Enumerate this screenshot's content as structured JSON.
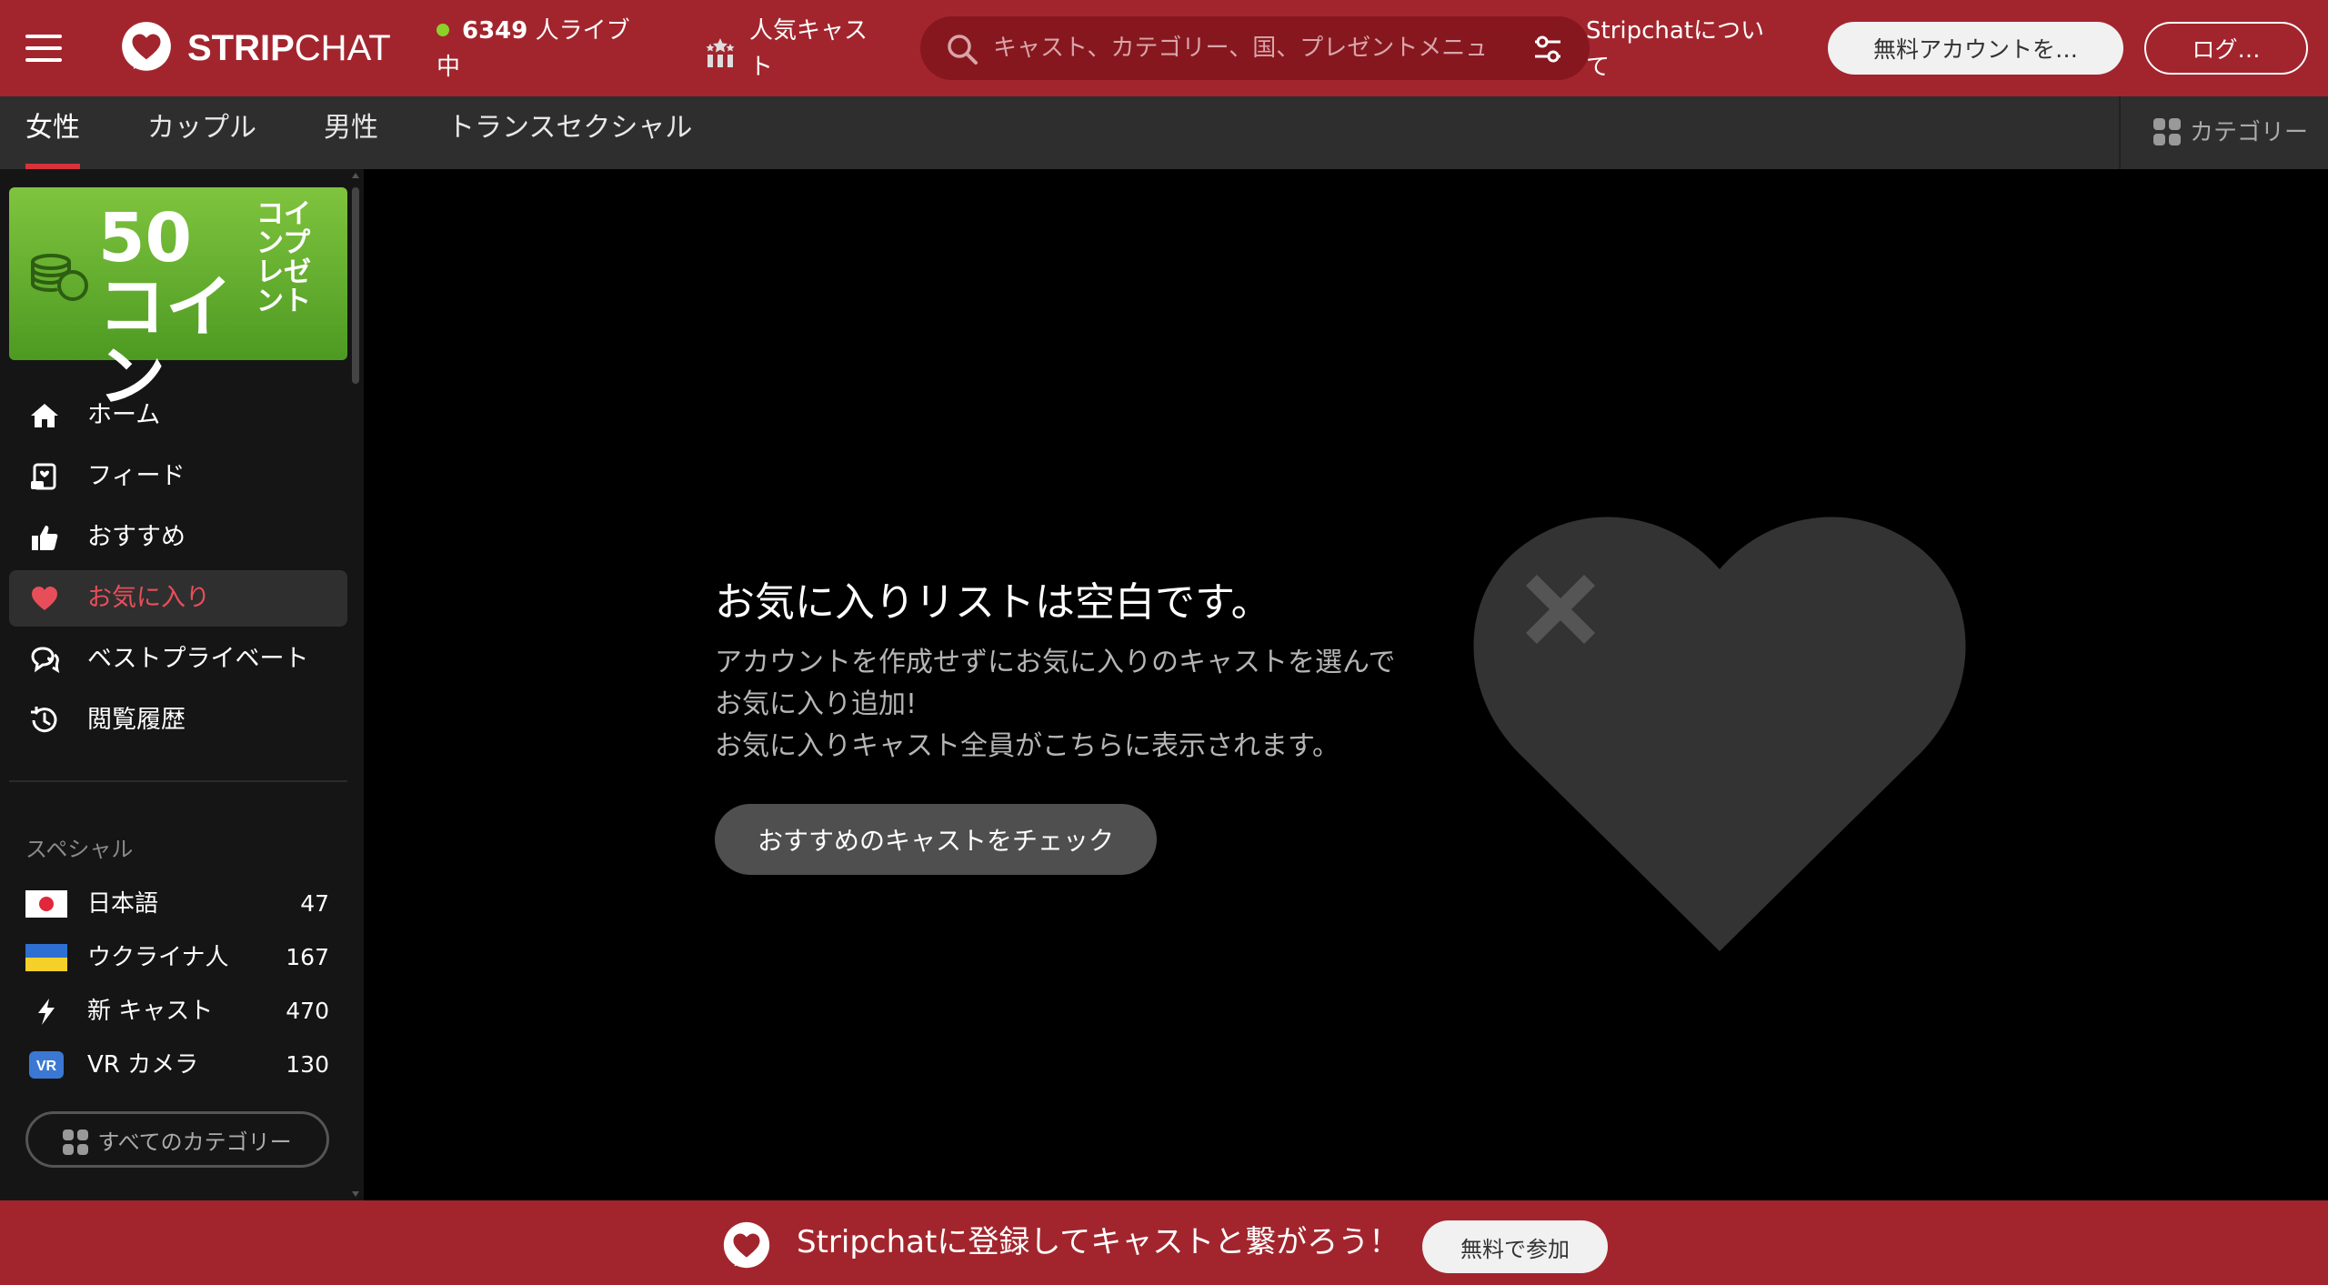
{
  "header": {
    "brand_strong": "STRIP",
    "brand_light": "CHAT",
    "live_count": "6349",
    "live_label_1": " 人ライブ",
    "live_label_2": "中",
    "popular_label_1": "人気キャス",
    "popular_label_2": "ト",
    "search_placeholder": "キャスト、カテゴリー、国、プレゼントメニュ",
    "about_1": "Stripchatについ",
    "about_2": "て",
    "signup_label": "無料アカウントを…",
    "login_label": "ログ…"
  },
  "subnav": {
    "tabs": [
      {
        "label": "女性"
      },
      {
        "label": "カップル"
      },
      {
        "label": "男性"
      },
      {
        "label": "トランスセクシャル"
      }
    ],
    "categories_label": "カテゴリー"
  },
  "sidebar": {
    "promo": {
      "big": "50コイン",
      "small": "コインプレゼント"
    },
    "nav": [
      {
        "label": "ホーム",
        "icon": "home-icon"
      },
      {
        "label": "フィード",
        "icon": "feed-icon"
      },
      {
        "label": "おすすめ",
        "icon": "thumbs-up-icon"
      },
      {
        "label": "お気に入り",
        "icon": "heart-icon"
      },
      {
        "label": "ベストプライベート",
        "icon": "chat-bubbles-icon"
      },
      {
        "label": "閲覧履歴",
        "icon": "history-icon"
      }
    ],
    "special_title": "スペシャル",
    "special": [
      {
        "label": "日本語",
        "count": "47",
        "icon": "japan-flag-icon"
      },
      {
        "label": "ウクライナ人",
        "count": "167",
        "icon": "ukraine-flag-icon"
      },
      {
        "label": "新 キャスト",
        "count": "470",
        "icon": "lightning-icon"
      },
      {
        "label": "VR カメラ",
        "count": "130",
        "icon": "vr-icon",
        "badge": "VR"
      }
    ],
    "all_categories_label": "すべてのカテゴリー"
  },
  "main": {
    "title": "お気に入りリストは空白です。",
    "desc_1": "アカウントを作成せずにお気に入りのキャストを選んで",
    "desc_2": "お気に入り追加!",
    "desc_3": "お気に入りキャスト全員がこちらに表示されます。",
    "cta_label": "おすすめのキャストをチェック"
  },
  "banner": {
    "text": "Stripchatに登録してキャストと繋がろう！",
    "button_label": "無料で参加"
  },
  "colors": {
    "brand_red": "#a2252d",
    "active_pink": "#e84e5a",
    "live_green": "#8bd12a",
    "promo_green": "#6fb634"
  }
}
